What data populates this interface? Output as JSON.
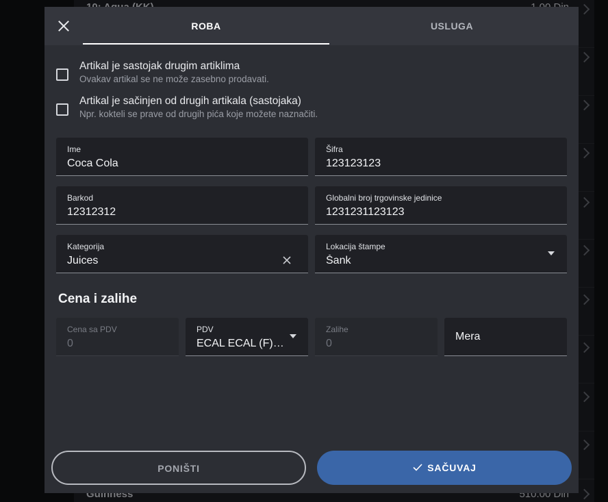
{
  "background": {
    "rows": [
      {
        "name": "10: Aqua (KK)",
        "price": "1.00 Din"
      },
      {
        "name": "Guinness",
        "price": "510.00 Din"
      }
    ]
  },
  "dialog": {
    "tabs": [
      {
        "label": "ROBA",
        "active": true
      },
      {
        "label": "USLUGA",
        "active": false
      }
    ],
    "options": [
      {
        "title": "Artikal je sastojak drugim artiklima",
        "subtitle": "Ovakav artikal se ne može zasebno prodavati.",
        "checked": false
      },
      {
        "title": "Artikal je sačinjen od drugih artikala (sastojaka)",
        "subtitle": "Npr. kokteli se prave od drugih pića koje možete naznačiti.",
        "checked": false
      }
    ],
    "fields": {
      "ime": {
        "label": "Ime",
        "value": "Coca Cola"
      },
      "sifra": {
        "label": "Šifra",
        "value": "123123123"
      },
      "barkod": {
        "label": "Barkod",
        "value": "12312312"
      },
      "gtin": {
        "label": "Globalni broj trgovinske jedinice",
        "value": "1231231123123"
      },
      "kategorija": {
        "label": "Kategorija",
        "value": "Juices"
      },
      "lokacija": {
        "label": "Lokacija štampe",
        "value": "Šank"
      }
    },
    "section_title": "Cena i zalihe",
    "price_fields": {
      "cena": {
        "label": "Cena sa PDV",
        "value": "0"
      },
      "pdv": {
        "label": "PDV",
        "value": "ECAL ECAL (F) - ..."
      },
      "zalihe": {
        "label": "Zalihe",
        "value": "0"
      },
      "mera": {
        "label": "Mera"
      }
    },
    "buttons": {
      "cancel": "PONIŠTI",
      "save": "SAČUVAJ"
    },
    "colors": {
      "primary": "#3a66a8",
      "surface": "#2c2e34",
      "header": "#34363d"
    }
  }
}
